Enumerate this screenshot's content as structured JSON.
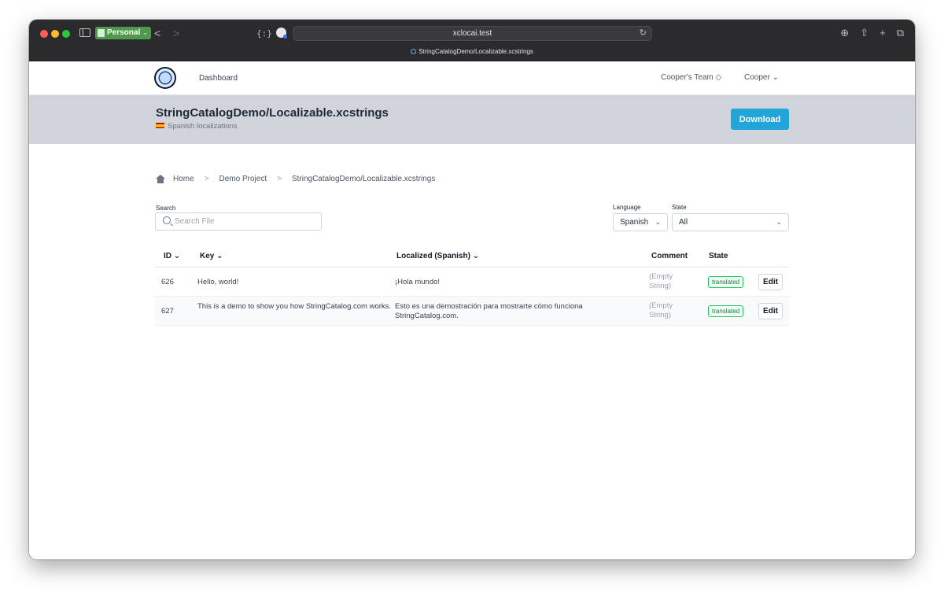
{
  "browser": {
    "profile": "Personal",
    "url": "xclocai.test",
    "tab_title": "StringCatalogDemo/Localizable.xcstrings",
    "icons": {
      "ext1": "{:}",
      "reload": "↻",
      "download": "⊕",
      "share": "⇧",
      "new_tab": "+",
      "tabs": "⧉"
    }
  },
  "topnav": {
    "dashboard": "Dashboard",
    "team": "Cooper's Team ◇",
    "user": "Cooper ⌄"
  },
  "header": {
    "title": "StringCatalogDemo/Localizable.xcstrings",
    "subtitle": "Spanish localizations",
    "download_label": "Download"
  },
  "breadcrumb": {
    "home": "Home",
    "project": "Demo Project",
    "file": "StringCatalogDemo/Localizable.xcstrings",
    "sep": ">"
  },
  "filters": {
    "search_label": "Search",
    "search_placeholder": "Search File",
    "language_label": "Language",
    "language_value": "Spanish",
    "state_label": "State",
    "state_value": "All"
  },
  "table": {
    "headers": {
      "id": "ID ⌄",
      "key": "Key ⌄",
      "localized": "Localized (Spanish) ⌄",
      "comment": "Comment",
      "state": "State"
    },
    "rows": [
      {
        "id": "626",
        "key": "Hello, world!",
        "localized": "¡Hola mundo!",
        "comment": "(Empty String)",
        "state": "translated",
        "action": "Edit"
      },
      {
        "id": "627",
        "key": "This is a demo to show you how StringCatalog.com works.",
        "localized": "Esto es una demostración para mostrarte cómo funciona StringCatalog.com.",
        "comment": "(Empty String)",
        "state": "translated",
        "action": "Edit"
      }
    ]
  },
  "colors": {
    "primary": "#22a5d8",
    "header_band": "#d1d5db",
    "badge_green": "#22c55e"
  }
}
